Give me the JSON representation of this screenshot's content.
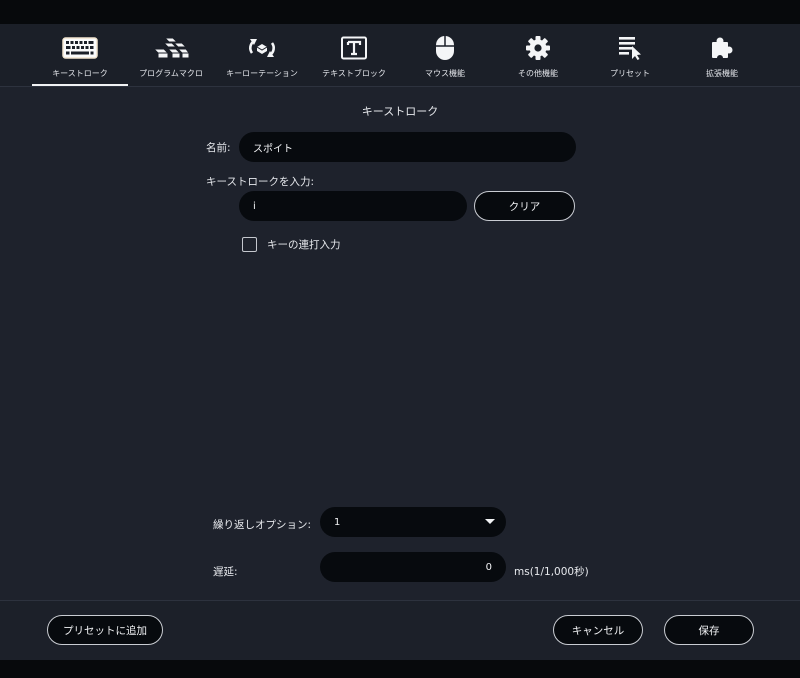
{
  "tabs": [
    {
      "label": "キーストローク",
      "icon": "keyboard-icon",
      "active": true
    },
    {
      "label": "プログラムマクロ",
      "icon": "blocks-icon",
      "active": false
    },
    {
      "label": "キーローテーション",
      "icon": "rotate-icon",
      "active": false
    },
    {
      "label": "テキストブロック",
      "icon": "text-block-icon",
      "active": false
    },
    {
      "label": "マウス機能",
      "icon": "mouse-icon",
      "active": false
    },
    {
      "label": "その他機能",
      "icon": "gear-icon",
      "active": false
    },
    {
      "label": "プリセット",
      "icon": "preset-list-icon",
      "active": false
    },
    {
      "label": "拡張機能",
      "icon": "puzzle-icon",
      "active": false
    }
  ],
  "section_title": "キーストローク",
  "name_label": "名前:",
  "name_value": "スポイト",
  "keystroke_label": "キーストロークを入力:",
  "keystroke_value": "i",
  "clear_label": "クリア",
  "repeat_input_label": "キーの連打入力",
  "repeat_input_checked": false,
  "repeat_option_label": "繰り返しオプション:",
  "repeat_option_value": "1",
  "delay_label": "遅延:",
  "delay_value": "0",
  "delay_unit": "ms(1/1,000秒)",
  "footer": {
    "add_preset_label": "プリセットに追加",
    "cancel_label": "キャンセル",
    "save_label": "保存"
  },
  "colors": {
    "background": "#1e222c",
    "field": "#070a0e",
    "text": "#e6e8ec",
    "active_tab_underline": "#f1f2f4"
  }
}
